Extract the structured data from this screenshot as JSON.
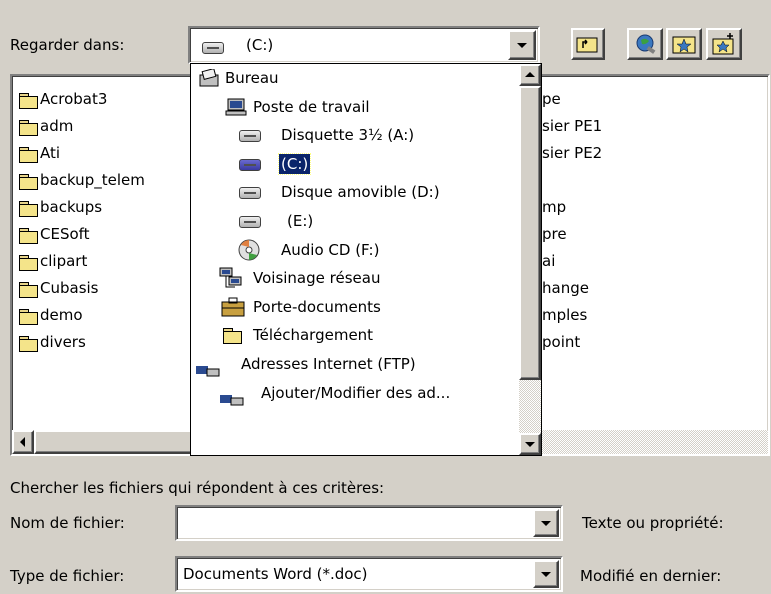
{
  "lookin": {
    "label": "Regarder dans:",
    "value": "(C:)"
  },
  "toolbar": {
    "up_icon": "up-folder-icon",
    "search_web_icon": "search-web-icon",
    "favorites_icon": "favorites-icon",
    "add_favorite_icon": "add-favorite-icon"
  },
  "files_left": [
    "Acrobat3",
    "adm",
    "Ati",
    "backup_telem",
    "backups",
    "CESoft",
    "clipart",
    "Cubasis",
    "demo",
    "divers"
  ],
  "files_right": [
    "pe",
    "sier PE1",
    "sier PE2",
    "",
    "mp",
    "pre",
    "ai",
    "hange",
    "mples",
    "point"
  ],
  "dropdown": {
    "items": [
      {
        "label": "Bureau",
        "icon": "desktop-icon"
      },
      {
        "label": "Poste de travail",
        "icon": "computer-icon"
      },
      {
        "label": "Disquette 3½ (A:)",
        "icon": "floppy-icon"
      },
      {
        "label": "(C:)",
        "icon": "harddrive-icon",
        "selected": true
      },
      {
        "label": "Disque amovible (D:)",
        "icon": "removable-drive-icon"
      },
      {
        "label": "(E:)",
        "icon": "drive-icon"
      },
      {
        "label": "Audio CD (F:)",
        "icon": "cd-icon"
      },
      {
        "label": "Voisinage réseau",
        "icon": "network-icon"
      },
      {
        "label": "Porte-documents",
        "icon": "briefcase-icon"
      },
      {
        "label": "Téléchargement",
        "icon": "folder-icon"
      },
      {
        "label": "Adresses Internet (FTP)",
        "icon": "ftp-icon"
      },
      {
        "label": "Ajouter/Modifier des ad...",
        "icon": "ftp-add-icon"
      }
    ]
  },
  "search": {
    "heading": "Chercher les fichiers qui répondent à ces critères:",
    "filename_label": "Nom de fichier:",
    "filename_value": "",
    "text_label": "Texte ou propriété:",
    "filetype_label": "Type de fichier:",
    "filetype_value": "Documents Word (*.doc)",
    "modified_label": "Modifié en dernier:"
  }
}
